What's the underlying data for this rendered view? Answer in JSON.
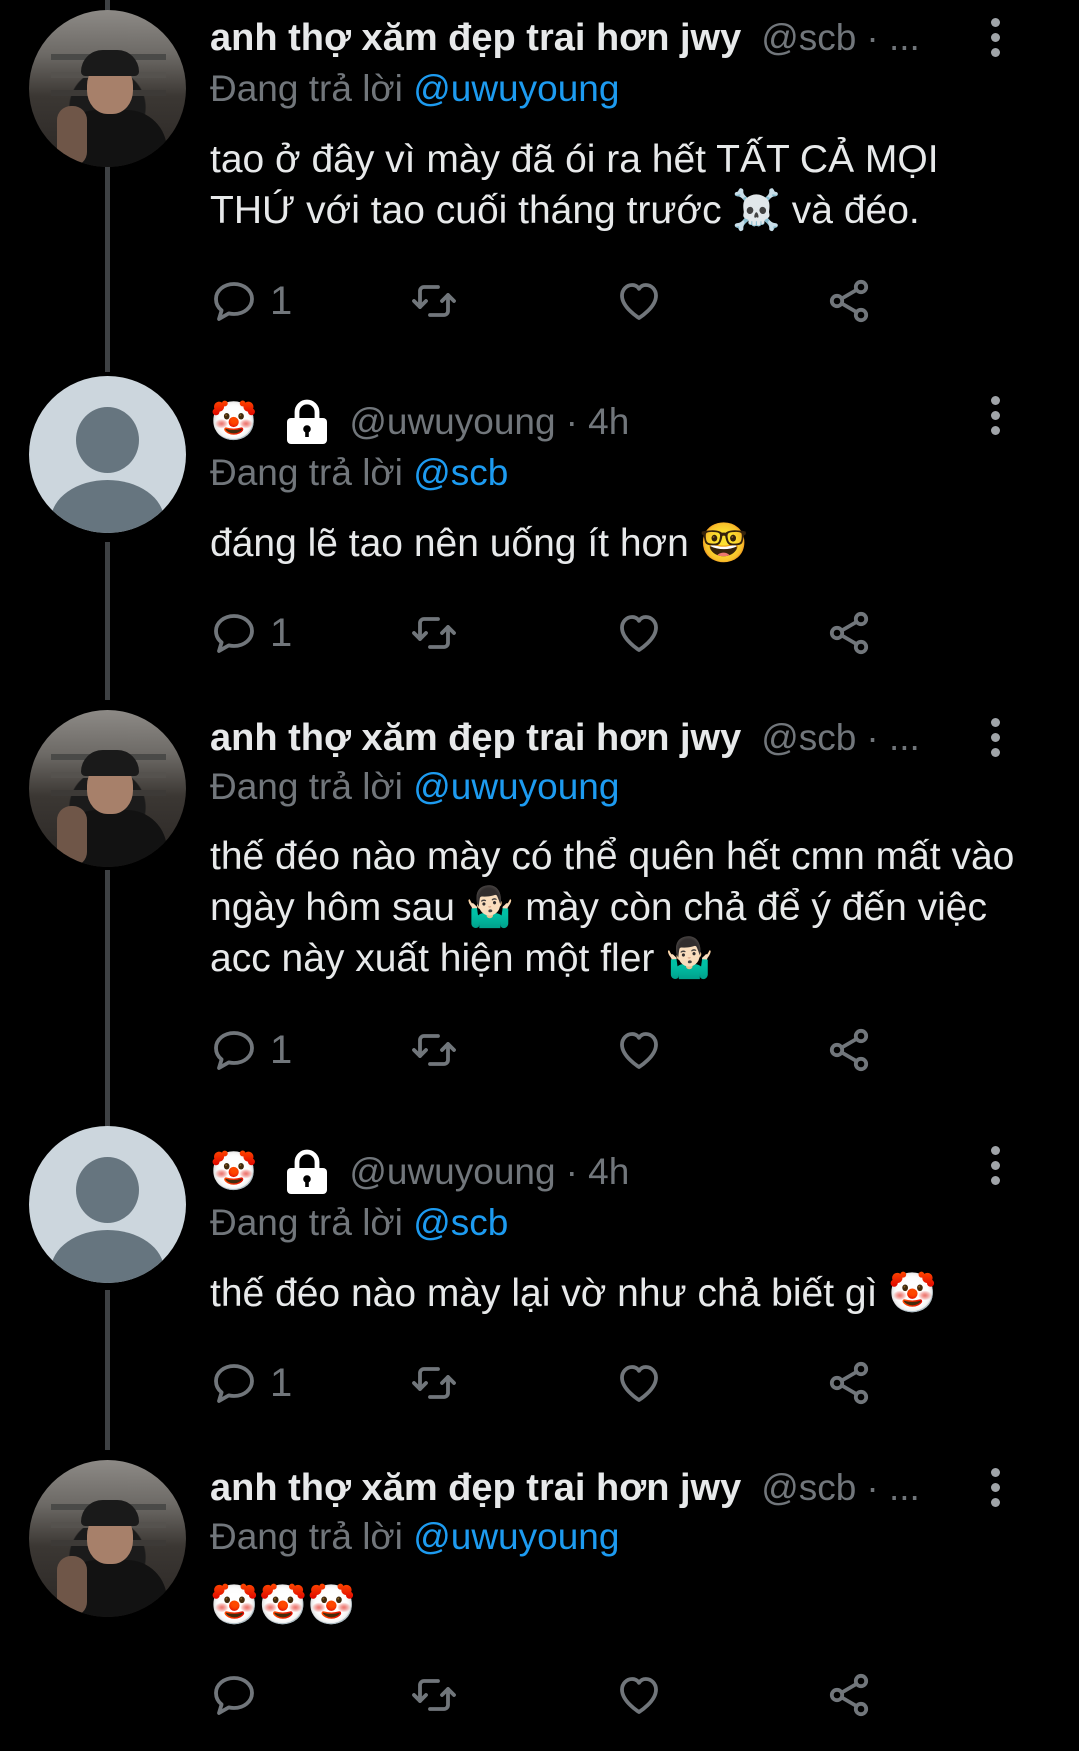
{
  "colors": {
    "background": "#000000",
    "text": "#e7e9ea",
    "muted": "#71767b",
    "accent": "#1d9bf0"
  },
  "tweets": [
    {
      "author_name": "anh thợ xăm đẹp trai hơn jwy",
      "author_emoji": "",
      "locked": false,
      "handle": "@scb",
      "time": "· ...",
      "reply_prefix": "Đang trả lời ",
      "reply_to": "@uwuyoung",
      "text": "tao ở đây vì mày đã ói ra hết TẤT CẢ MỌI THỨ với tao cuối tháng trước ☠️ và đéo.",
      "reply_count": "1",
      "avatar": "photo"
    },
    {
      "author_name": "",
      "author_emoji": "🤡",
      "locked": true,
      "handle": "@uwuyoung",
      "time": "· 4h",
      "reply_prefix": "Đang trả lời ",
      "reply_to": "@scb",
      "text": "đáng lẽ tao nên uống ít hơn 🤓",
      "reply_count": "1",
      "avatar": "default"
    },
    {
      "author_name": "anh thợ xăm đẹp trai hơn jwy",
      "author_emoji": "",
      "locked": false,
      "handle": "@scb",
      "time": "· ...",
      "reply_prefix": "Đang trả lời ",
      "reply_to": "@uwuyoung",
      "text": "thế đéo nào mày có thể quên hết cmn mất vào ngày hôm sau 🤷🏻‍♂️ mày còn chả để ý đến việc acc này xuất hiện một fler 🤷🏻‍♂️",
      "reply_count": "1",
      "avatar": "photo"
    },
    {
      "author_name": "",
      "author_emoji": "🤡",
      "locked": true,
      "handle": "@uwuyoung",
      "time": "· 4h",
      "reply_prefix": "Đang trả lời ",
      "reply_to": "@scb",
      "text": "thế đéo nào mày lại vờ như chả biết gì 🤡",
      "reply_count": "1",
      "avatar": "default"
    },
    {
      "author_name": "anh thợ xăm đẹp trai hơn jwy",
      "author_emoji": "",
      "locked": false,
      "handle": "@scb",
      "time": "· ...",
      "reply_prefix": "Đang trả lời ",
      "reply_to": "@uwuyoung",
      "text": "🤡🤡🤡",
      "reply_count": "",
      "avatar": "photo"
    }
  ],
  "icons": {
    "reply": "reply-bubble-icon",
    "retweet": "retweet-icon",
    "like": "heart-icon",
    "share": "share-icon",
    "more": "more-vertical-icon",
    "lock": "lock-icon"
  }
}
